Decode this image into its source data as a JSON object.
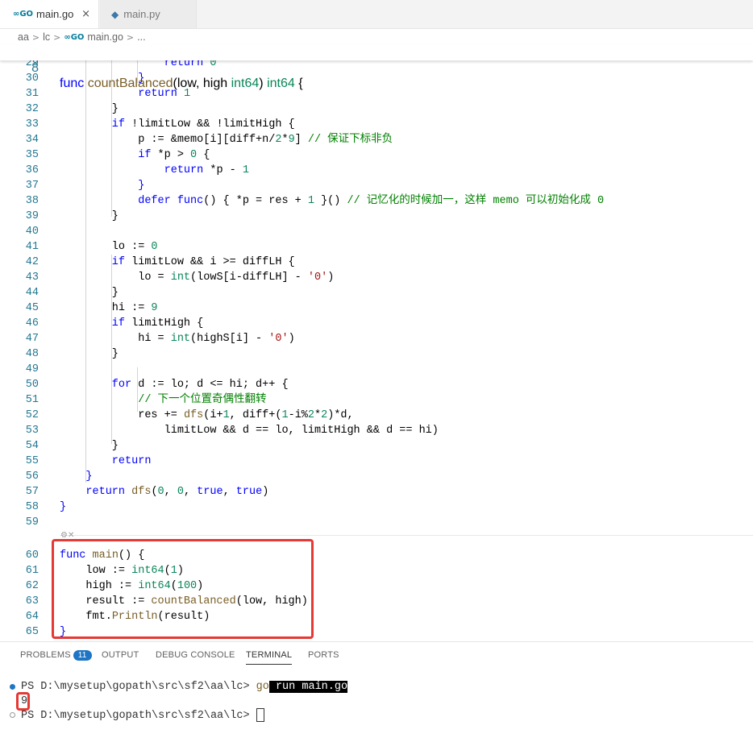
{
  "tabs": [
    {
      "icon": "go-file-icon",
      "icon_text": "∞GO",
      "label": "main.go",
      "close": "×"
    },
    {
      "icon": "python-file-icon",
      "icon_text": "◆",
      "label": "main.py"
    }
  ],
  "breadcrumb": [
    "aa",
    "lc",
    "main.go",
    "..."
  ],
  "breadcrumb_go_icon": "∞GO",
  "sticky": {
    "ln": "8",
    "parts": [
      [
        "k",
        "func "
      ],
      [
        "f",
        "countBalanced"
      ],
      [
        "p",
        "(low, high "
      ],
      [
        "n",
        "int64"
      ],
      [
        "p",
        ") "
      ],
      [
        "n",
        "int64"
      ],
      [
        "p",
        " {"
      ]
    ]
  },
  "lines": [
    {
      "ln": "29",
      "parts": [
        [
          "k",
          "                return "
        ],
        [
          "n",
          "0"
        ]
      ]
    },
    {
      "ln": "30",
      "parts": [
        [
          "k",
          "            }"
        ]
      ]
    },
    {
      "ln": "31",
      "parts": [
        [
          "k",
          "            return "
        ],
        [
          "n",
          "1"
        ]
      ]
    },
    {
      "ln": "32",
      "parts": [
        [
          "p",
          "        }"
        ]
      ]
    },
    {
      "ln": "33",
      "parts": [
        [
          "k",
          "        if "
        ],
        [
          "p",
          "!limitLow && !limitHigh {"
        ]
      ]
    },
    {
      "ln": "34",
      "parts": [
        [
          "p",
          "            p := &memo[i][diff+n/"
        ],
        [
          "n",
          "2"
        ],
        [
          "p",
          "*"
        ],
        [
          "n",
          "9"
        ],
        [
          "p",
          "] "
        ],
        [
          "c",
          "// 保证下标非负"
        ]
      ]
    },
    {
      "ln": "35",
      "parts": [
        [
          "k",
          "            if "
        ],
        [
          "p",
          "*p > "
        ],
        [
          "n",
          "0"
        ],
        [
          "p",
          " {"
        ]
      ]
    },
    {
      "ln": "36",
      "parts": [
        [
          "k",
          "                return "
        ],
        [
          "p",
          "*p - "
        ],
        [
          "n",
          "1"
        ]
      ]
    },
    {
      "ln": "37",
      "parts": [
        [
          "k",
          "            }"
        ]
      ]
    },
    {
      "ln": "38",
      "parts": [
        [
          "k",
          "            defer func"
        ],
        [
          "p",
          "() { *p = res + "
        ],
        [
          "n",
          "1"
        ],
        [
          "p",
          " }() "
        ],
        [
          "c",
          "// 记忆化的时候加一，这样 memo 可以初始化成 0"
        ]
      ]
    },
    {
      "ln": "39",
      "parts": [
        [
          "p",
          "        }"
        ]
      ]
    },
    {
      "ln": "40",
      "parts": [
        [
          "p",
          ""
        ]
      ]
    },
    {
      "ln": "41",
      "parts": [
        [
          "p",
          "        lo := "
        ],
        [
          "n",
          "0"
        ]
      ]
    },
    {
      "ln": "42",
      "parts": [
        [
          "k",
          "        if "
        ],
        [
          "p",
          "limitLow && i >= diffLH {"
        ]
      ]
    },
    {
      "ln": "43",
      "parts": [
        [
          "p",
          "            lo = "
        ],
        [
          "n",
          "int"
        ],
        [
          "p",
          "(lowS[i-diffLH] - "
        ],
        [
          "s",
          "'0'"
        ],
        [
          "p",
          ")"
        ]
      ]
    },
    {
      "ln": "44",
      "parts": [
        [
          "p",
          "        }"
        ]
      ]
    },
    {
      "ln": "45",
      "parts": [
        [
          "p",
          "        hi := "
        ],
        [
          "n",
          "9"
        ]
      ]
    },
    {
      "ln": "46",
      "parts": [
        [
          "k",
          "        if "
        ],
        [
          "p",
          "limitHigh {"
        ]
      ]
    },
    {
      "ln": "47",
      "parts": [
        [
          "p",
          "            hi = "
        ],
        [
          "n",
          "int"
        ],
        [
          "p",
          "(highS[i] - "
        ],
        [
          "s",
          "'0'"
        ],
        [
          "p",
          ")"
        ]
      ]
    },
    {
      "ln": "48",
      "parts": [
        [
          "p",
          "        }"
        ]
      ]
    },
    {
      "ln": "49",
      "parts": [
        [
          "p",
          ""
        ]
      ]
    },
    {
      "ln": "50",
      "parts": [
        [
          "k",
          "        for "
        ],
        [
          "p",
          "d := lo; d <= hi; d++ {"
        ]
      ]
    },
    {
      "ln": "51",
      "parts": [
        [
          "c",
          "            // 下一个位置奇偶性翻转"
        ]
      ]
    },
    {
      "ln": "52",
      "parts": [
        [
          "p",
          "            res += "
        ],
        [
          "f",
          "dfs"
        ],
        [
          "p",
          "(i+"
        ],
        [
          "n",
          "1"
        ],
        [
          "p",
          ", diff+("
        ],
        [
          "n",
          "1"
        ],
        [
          "p",
          "-i%"
        ],
        [
          "n",
          "2"
        ],
        [
          "p",
          "*"
        ],
        [
          "n",
          "2"
        ],
        [
          "p",
          ")*d,"
        ]
      ]
    },
    {
      "ln": "53",
      "parts": [
        [
          "p",
          "                limitLow && d == lo, limitHigh && d == hi)"
        ]
      ]
    },
    {
      "ln": "54",
      "parts": [
        [
          "p",
          "        }"
        ]
      ]
    },
    {
      "ln": "55",
      "parts": [
        [
          "k",
          "        return"
        ]
      ]
    },
    {
      "ln": "56",
      "parts": [
        [
          "k",
          "    }"
        ]
      ]
    },
    {
      "ln": "57",
      "parts": [
        [
          "k",
          "    return "
        ],
        [
          "f",
          "dfs"
        ],
        [
          "p",
          "("
        ],
        [
          "n",
          "0"
        ],
        [
          "p",
          ", "
        ],
        [
          "n",
          "0"
        ],
        [
          "p",
          ", "
        ],
        [
          "k",
          "true"
        ],
        [
          "p",
          ", "
        ],
        [
          "k",
          "true"
        ],
        [
          "p",
          ")"
        ]
      ]
    },
    {
      "ln": "58",
      "parts": [
        [
          "k",
          "}"
        ]
      ]
    },
    {
      "ln": "59",
      "parts": [
        [
          "p",
          ""
        ]
      ]
    },
    {
      "ln": "",
      "parts": [
        [
          "p",
          ""
        ]
      ]
    },
    {
      "ln": "60",
      "parts": [
        [
          "k",
          "func "
        ],
        [
          "f",
          "main"
        ],
        [
          "p",
          "() {"
        ]
      ]
    },
    {
      "ln": "61",
      "parts": [
        [
          "p",
          "    low := "
        ],
        [
          "n",
          "int64"
        ],
        [
          "p",
          "("
        ],
        [
          "n",
          "1"
        ],
        [
          "p",
          ")"
        ]
      ]
    },
    {
      "ln": "62",
      "parts": [
        [
          "p",
          "    high := "
        ],
        [
          "n",
          "int64"
        ],
        [
          "p",
          "("
        ],
        [
          "n",
          "100"
        ],
        [
          "p",
          ")"
        ]
      ]
    },
    {
      "ln": "63",
      "parts": [
        [
          "p",
          "    result := "
        ],
        [
          "f",
          "countBalanced"
        ],
        [
          "p",
          "(low, high)"
        ]
      ]
    },
    {
      "ln": "64",
      "parts": [
        [
          "p",
          "    fmt."
        ],
        [
          "f",
          "Println"
        ],
        [
          "p",
          "(result)"
        ]
      ]
    },
    {
      "ln": "65",
      "parts": [
        [
          "k",
          "}"
        ]
      ]
    }
  ],
  "fold_glyph": "⚙✕",
  "panel_tabs": [
    {
      "label": "PROBLEMS",
      "badge": "11"
    },
    {
      "label": "OUTPUT"
    },
    {
      "label": "DEBUG CONSOLE"
    },
    {
      "label": "TERMINAL",
      "active": true
    },
    {
      "label": "PORTS"
    }
  ],
  "terminal": {
    "prompt1": "PS D:\\mysetup\\gopath\\src\\sf2\\aa\\lc> ",
    "cmd_go": "go",
    "cmd_rest": " run main.go",
    "output": "9",
    "prompt2": "PS D:\\mysetup\\gopath\\src\\sf2\\aa\\lc> "
  },
  "colors": {
    "accent": "#1e75c5",
    "highlight_box": "#e53935",
    "keyword": "#0000ff",
    "comment": "#008000",
    "number": "#098658"
  }
}
